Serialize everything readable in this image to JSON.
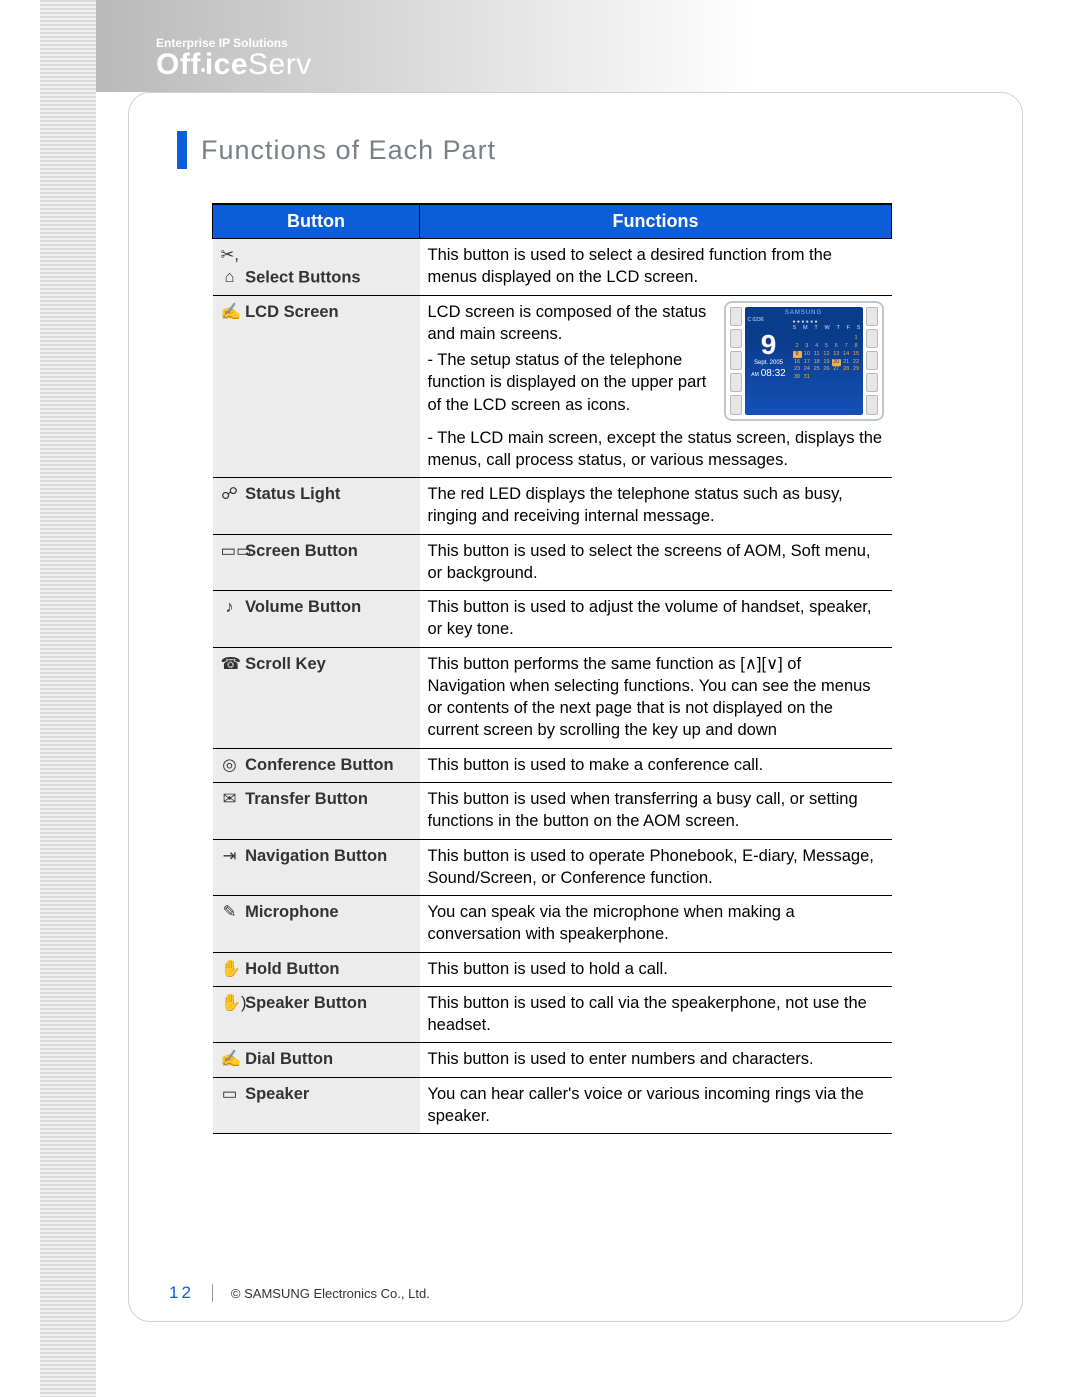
{
  "header": {
    "tagline": "Enterprise IP Solutions",
    "brand_bold": "Office",
    "brand_light": "Serv"
  },
  "section_title": "Functions of Each Part",
  "columns": {
    "button": "Button",
    "functions": "Functions"
  },
  "rows": {
    "select": {
      "icons": "✂, ⌂",
      "label": "Select Buttons",
      "desc": "This button is used to select a desired function from the menus displayed on the LCD screen."
    },
    "lcd": {
      "icons": "✍",
      "label": "LCD Screen",
      "desc_intro": "LCD screen is composed of the status and main screens.",
      "desc_b1": "- The setup status of the telephone function is displayed on the upper part of the LCD screen as icons.",
      "desc_b2": "- The LCD main screen, except the status screen, displays the menus, call process status, or various messages."
    },
    "status": {
      "icons": "☍",
      "label": "Status Light",
      "desc": "The red LED displays the telephone status such as busy, ringing and receiving internal message."
    },
    "screen": {
      "icons": "▭▭",
      "label": "Screen Button",
      "desc": "This button is used to select the screens of AOM, Soft menu, or background."
    },
    "volume": {
      "icons": "♪",
      "label": "Volume Button",
      "desc": "This button is used to adjust the volume of handset, speaker, or key tone."
    },
    "scroll": {
      "icons": "☎",
      "label": "Scroll Key",
      "desc": "This button performs the same function as [∧][∨] of Navigation when selecting functions. You can see the menus or contents of the next page that is not displayed on the current screen by scrolling the key up and down"
    },
    "conf": {
      "icons": "◎",
      "label": "Conference Button",
      "desc": "This button is used to make a conference call."
    },
    "transfer": {
      "icons": "✉",
      "label": "Transfer Button",
      "desc": "This button is used when transferring a busy call, or setting functions in the button on the AOM screen."
    },
    "nav": {
      "icons": "⇥",
      "label": "Navigation Button",
      "desc": "This button is used to operate Phonebook, E-diary, Message, Sound/Screen, or Conference function."
    },
    "mic": {
      "icons": "✎",
      "label": "Microphone",
      "desc": "You can speak via the microphone when making a conversation with speakerphone."
    },
    "hold": {
      "icons": "✋",
      "label": "Hold Button",
      "desc": "This button is used to hold a call."
    },
    "spkbtn": {
      "icons": "✋)",
      "label": "Speaker Button",
      "desc": "This button is used to call via the speakerphone, not use the headset."
    },
    "dial": {
      "icons": "✍",
      "label": "Dial Button",
      "desc": "This button is used to enter numbers and characters."
    },
    "speaker": {
      "icons": "▭",
      "label": "Speaker",
      "desc": "You can hear caller's voice or various incoming rings via the speaker."
    }
  },
  "lcd_mock": {
    "brand": "SAMSUNG",
    "code": "C 0236",
    "big": "9",
    "month": "Sept. 2005",
    "am": "AM",
    "time": "08:32",
    "dow": [
      "S",
      "M",
      "T",
      "W",
      "T",
      "F",
      "S"
    ]
  },
  "footer": {
    "page": "12",
    "copyright": "© SAMSUNG Electronics Co., Ltd."
  }
}
